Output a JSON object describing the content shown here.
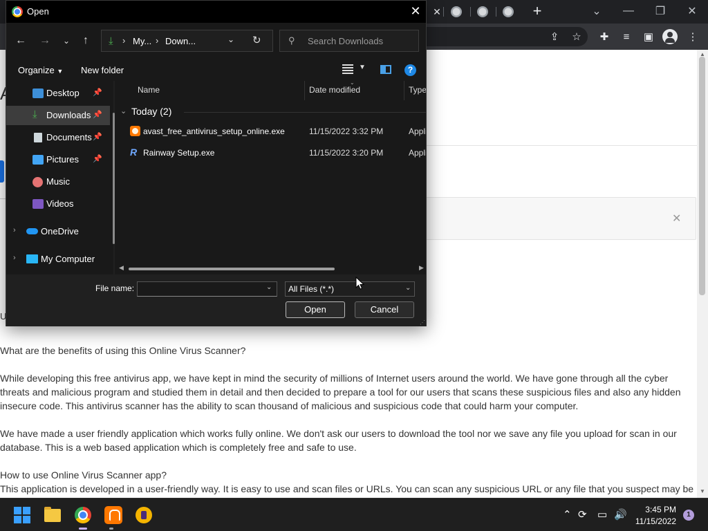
{
  "dialog": {
    "title": "Open",
    "address": {
      "crumb1": "My...",
      "crumb2": "Down..."
    },
    "search_placeholder": "Search Downloads",
    "toolbar": {
      "organize": "Organize",
      "new_folder": "New folder"
    },
    "nav_items": [
      {
        "label": "Desktop",
        "icon": "desktop-icon",
        "pinned": true
      },
      {
        "label": "Downloads",
        "icon": "downloads-icon",
        "pinned": true,
        "selected": true
      },
      {
        "label": "Documents",
        "icon": "documents-icon",
        "pinned": true
      },
      {
        "label": "Pictures",
        "icon": "pictures-icon",
        "pinned": true
      },
      {
        "label": "Music",
        "icon": "music-icon",
        "pinned": false
      },
      {
        "label": "Videos",
        "icon": "videos-icon",
        "pinned": false
      },
      {
        "label": "OneDrive",
        "icon": "onedrive-icon",
        "expandable": true
      },
      {
        "label": "My Computer",
        "icon": "computer-icon",
        "expandable": true
      }
    ],
    "columns": {
      "name": "Name",
      "date_modified": "Date modified",
      "type": "Type"
    },
    "group_label": "Today (2)",
    "files": [
      {
        "name": "avast_free_antivirus_setup_online.exe",
        "date": "11/15/2022 3:32 PM",
        "type": "Appli",
        "icon": "avast-icon"
      },
      {
        "name": "Rainway Setup.exe",
        "date": "11/15/2022 3:20 PM",
        "type": "Appli",
        "icon": "rainway-icon"
      }
    ],
    "file_name_label": "File name:",
    "file_name_value": "",
    "filter_value": "All Files (*.*)",
    "open_label": "Open",
    "cancel_label": "Cancel"
  },
  "page": {
    "paragraphs": [
      "What are the benefits of using this Online Virus Scanner?",
      "While developing this free antivirus app, we have kept in mind the security of millions of Internet users around the world. We have gone through all the cyber threats and malicious program and studied them in detail and then decided to prepare a tool for our users that scans these suspicious files and also any hidden insecure code. This antivirus scanner has the ability to scan thousand of malicious and suspicious code that could harm your computer.",
      "We have made a user friendly application which works fully online. We don't ask our users to download the tool nor we save any file you upload for scan in our database. This is a web based application which is completely free and safe to use.",
      "How to use Online Virus Scanner app?",
      "This application is developed in a user-friendly way. It is easy to use and scan files or URLs. You can scan any suspicious URL or any file that you suspect may be"
    ],
    "left_letter": "A",
    "left_u": "U"
  },
  "taskbar": {
    "time": "3:45 PM",
    "date": "11/15/2022",
    "notification_count": "1"
  },
  "colors": {
    "dialog_bg": "#202020",
    "accent_blue": "#1e88e5",
    "downloads_green": "#4caf50",
    "taskbar_bg": "#1f1f1f"
  }
}
